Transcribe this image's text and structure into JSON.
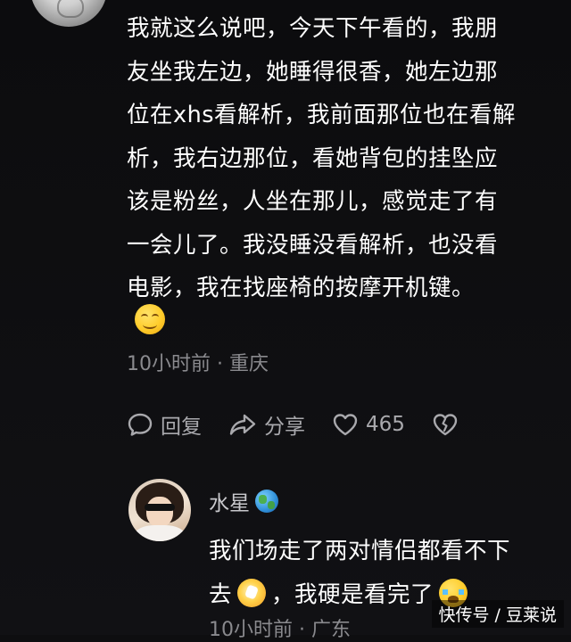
{
  "comment": {
    "lines": [
      "我就这么说吧，今天下午看的，我朋",
      "友坐我左边，她睡得很香，她左边那",
      "位在xhs看解析，我前面那位也在看解",
      "析，我右边那位，看她背包的挂坠应",
      "该是粉丝，人坐在那儿，感觉走了有",
      "一会儿了。我没睡没看解析，也没看",
      "电影，我在找座椅的按摩开机键。"
    ],
    "emoji": "smile-emoji",
    "meta": "10小时前 · 重庆",
    "actions": {
      "reply_label": "回复",
      "share_label": "分享",
      "like_count": "465"
    }
  },
  "reply": {
    "name": "水星",
    "name_badge": "globe-icon",
    "line1": "我们场走了两对情侣都看不下",
    "line2_part1": "去",
    "line2_part2": "，我硬是看完了",
    "meta": "10小时前 · 广东"
  },
  "watermark": "快传号 / 豆莱说",
  "colors": {
    "background": "#0e0e10",
    "text": "#ffffff",
    "meta": "#8a8a8e",
    "action": "#a9a9ad"
  }
}
